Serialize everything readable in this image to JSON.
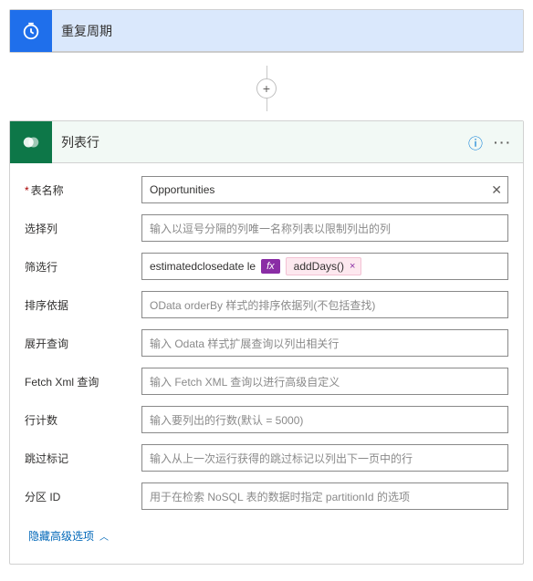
{
  "trigger": {
    "title": "重复周期",
    "icon": "clock-icon"
  },
  "action": {
    "title": "列表行",
    "icon": "dataverse-icon",
    "help": "?",
    "menu": "···"
  },
  "fields": {
    "tableName": {
      "label": "表名称",
      "value": "Opportunities",
      "clear": "✕"
    },
    "selectColumns": {
      "label": "选择列",
      "placeholder": "输入以逗号分隔的列唯一名称列表以限制列出的列"
    },
    "filterRows": {
      "label": "筛选行",
      "prefix": "estimatedclosedate le",
      "fx": "fx",
      "token": "addDays()",
      "tokenClose": "×"
    },
    "orderBy": {
      "label": "排序依据",
      "placeholder": "OData orderBy 样式的排序依据列(不包括查找)"
    },
    "expand": {
      "label": "展开查询",
      "placeholder": "输入 Odata 样式扩展查询以列出相关行"
    },
    "fetchXml": {
      "label": "Fetch Xml 查询",
      "placeholder": "输入 Fetch XML 查询以进行高级自定义"
    },
    "rowCount": {
      "label": "行计数",
      "placeholder": "输入要列出的行数(默认 = 5000)"
    },
    "skipToken": {
      "label": "跳过标记",
      "placeholder": "输入从上一次运行获得的跳过标记以列出下一页中的行"
    },
    "partitionId": {
      "label": "分区 ID",
      "placeholder": "用于在检索 NoSQL 表的数据时指定 partitionId 的选项"
    }
  },
  "advancedLink": "隐藏高级选项",
  "plus": "+"
}
